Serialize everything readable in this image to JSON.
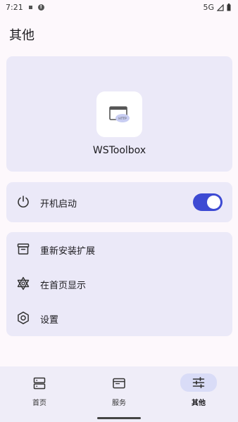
{
  "status_bar": {
    "time": "7:21",
    "network": "5G"
  },
  "page": {
    "title": "其他"
  },
  "app": {
    "name": "WSToolbox",
    "icon_badge": "HTTP",
    "icon": "browser-window-icon"
  },
  "boot": {
    "label": "开机启动",
    "icon": "power-icon",
    "enabled": true
  },
  "menu": {
    "items": [
      {
        "label": "重新安装扩展",
        "icon": "archive-box-icon"
      },
      {
        "label": "在首页显示",
        "icon": "star-of-david-icon"
      },
      {
        "label": "设置",
        "icon": "gear-icon"
      }
    ]
  },
  "nav": {
    "items": [
      {
        "label": "首页",
        "icon": "server-icon"
      },
      {
        "label": "服务",
        "icon": "browser-icon"
      },
      {
        "label": "其他",
        "icon": "sliders-icon",
        "active": true
      }
    ]
  },
  "colors": {
    "accent": "#3d4ad3",
    "card": "#ebe9f8",
    "background": "#fdf8fc",
    "nav_active": "#d9dcf7"
  }
}
